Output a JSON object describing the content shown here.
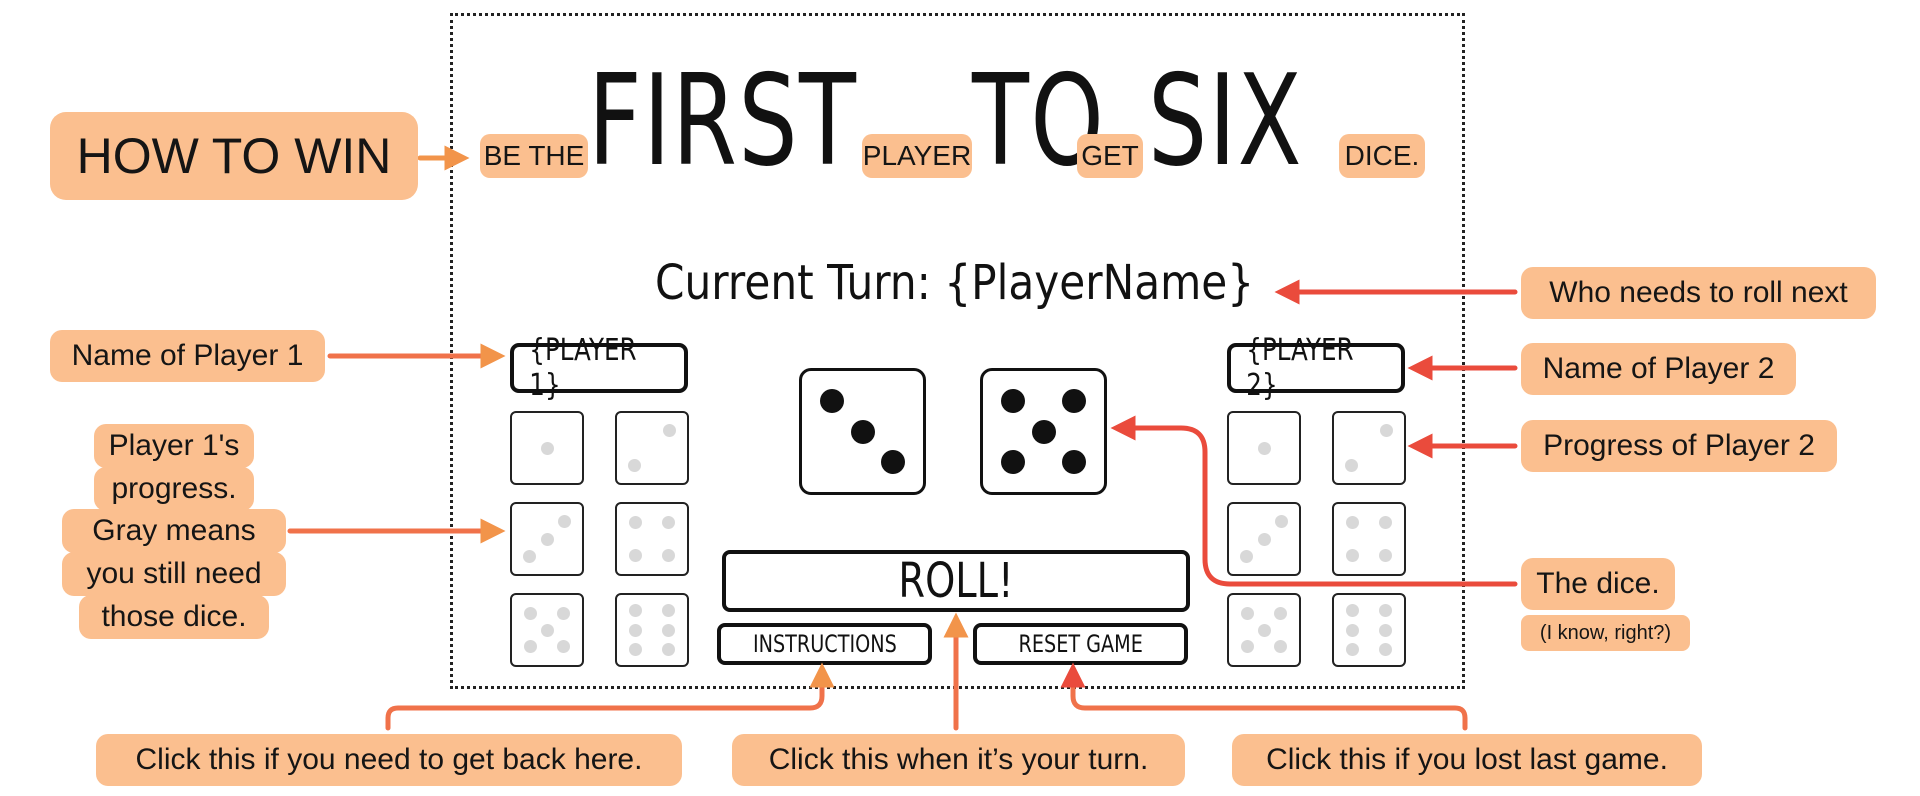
{
  "game": {
    "title_words": [
      "BE THE",
      "FIRST",
      "PLAYER",
      "TO",
      "GET",
      "SIX",
      "DICE."
    ],
    "current_turn": "Current Turn: {PlayerName}",
    "player1_name": "{PLAYER 1}",
    "player2_name": "{PLAYER 2}",
    "roll_label": "ROLL!",
    "instructions_label": "INSTRUCTIONS",
    "reset_label": "RESET GAME",
    "dice_values": [
      3,
      5
    ],
    "progress_dice": [
      1,
      2,
      3,
      4,
      5,
      6
    ]
  },
  "annotations": {
    "how_to_win": "HOW TO WIN",
    "who_rolls": "Who needs to roll next",
    "name_p1": "Name of Player 1",
    "name_p2": "Name of Player 2",
    "progress_p1": [
      "Player 1's",
      "progress.",
      "Gray means",
      "you still need",
      "those dice."
    ],
    "progress_p2": "Progress of Player 2",
    "the_dice": "The dice.",
    "the_dice_note": "(I know, right?)",
    "instructions_note": "Click this if you need to get back here.",
    "roll_note": "Click this when it’s your turn.",
    "reset_note": "Click this if you lost last game."
  },
  "colors": {
    "callout_bg": "#fbbf8f",
    "arrow_red": "#ea4b3c",
    "arrow_orange": "#f2944a",
    "pip_gray": "#d8d8d8"
  }
}
